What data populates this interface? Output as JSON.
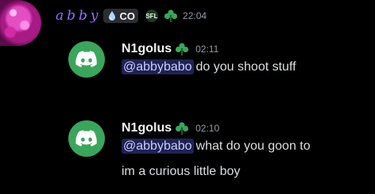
{
  "top_message": {
    "username": "abby",
    "tag": {
      "icon": "water-drop-icon",
      "text": "CO"
    },
    "badge": "SFL",
    "timestamp": "22:04"
  },
  "messages": [
    {
      "username": "N1golus",
      "timestamp": "02:11",
      "mention": "@abbybabo",
      "text_line_1": "do you shoot stuff"
    },
    {
      "username": "N1golus",
      "timestamp": "02:10",
      "mention": "@abbybabo",
      "text_line_1": "what do you goon to",
      "text_line_2": "im a curious little boy"
    }
  ],
  "colors": {
    "background": "#000000",
    "avatar_green": "#3ba55c",
    "mention_bg": "#5865f2",
    "clover_green": "#3ba55c",
    "top_username": "#9a6dff"
  }
}
